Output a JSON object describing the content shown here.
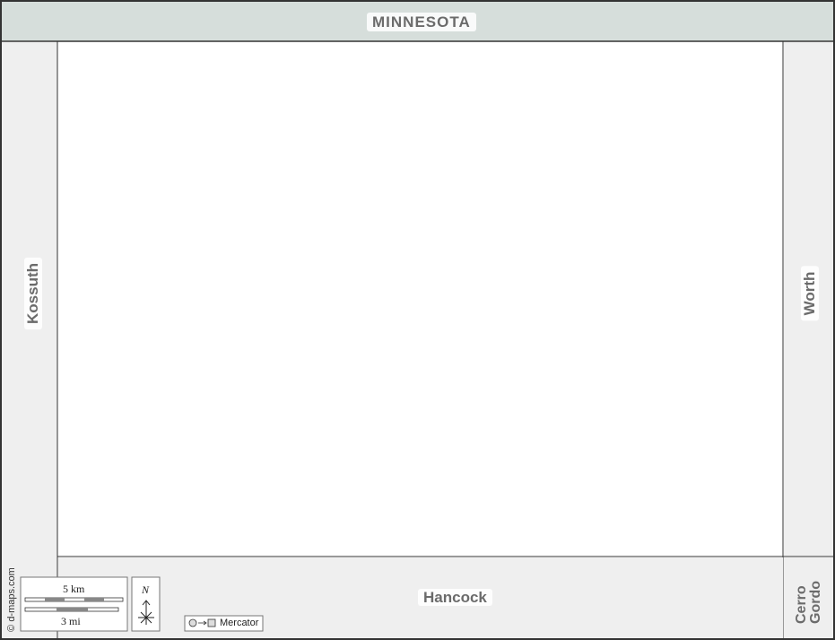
{
  "labels": {
    "north_state": "MINNESOTA",
    "west_county": "Kossuth",
    "east_county": "Worth",
    "south_county": "Hancock",
    "southeast_county_line1": "Cerro",
    "southeast_county_line2": "Gordo"
  },
  "credit": "© d-maps.com",
  "scale": {
    "km_label": "5 km",
    "mi_label": "3 mi"
  },
  "north_arrow": {
    "label": "N"
  },
  "projection": {
    "label": "Mercator"
  },
  "colors": {
    "background": "#ffffff",
    "neighbor_state": "#d6dedb",
    "neighbor_county": "#efefef",
    "border": "#333333",
    "label_text": "#6b6b6b"
  }
}
